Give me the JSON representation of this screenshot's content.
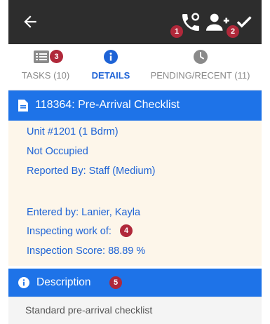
{
  "header": {
    "back_icon": "arrow-left-icon",
    "actions": [
      {
        "icon": "phone-callback-icon",
        "badge": "1"
      },
      {
        "icon": "add-user-icon"
      },
      {
        "icon": "checkmark-icon",
        "badge": "2"
      }
    ]
  },
  "tabs": [
    {
      "icon": "list-icon",
      "label": "TASKS (10)",
      "badge": "3",
      "active": false
    },
    {
      "icon": "info-icon",
      "label": "DETAILS",
      "active": true
    },
    {
      "icon": "clock-icon",
      "label": "PENDING/RECENT (11)",
      "active": false
    }
  ],
  "checklist": {
    "icon": "file-icon",
    "title": "118364: Pre-Arrival Checklist"
  },
  "details": {
    "unit": "Unit #1201 (1 Bdrm)",
    "occupancy": "Not Occupied",
    "reported_by": "Reported By: Staff  (Medium)",
    "entered_by": "Entered by: Lanier, Kayla",
    "inspecting": "Inspecting work of:",
    "inspecting_badge": "4",
    "score": "Inspection Score: 88.89 %"
  },
  "description": {
    "icon": "info-icon",
    "title": "Description",
    "badge": "5",
    "text": "Standard pre-arrival checklist"
  },
  "colors": {
    "appbar": "#2d2d2d",
    "accent_blue": "#1e73e8",
    "active_tab": "#1e63d6",
    "details_bg": "#fdf6ea",
    "badge": "#b0283a"
  }
}
